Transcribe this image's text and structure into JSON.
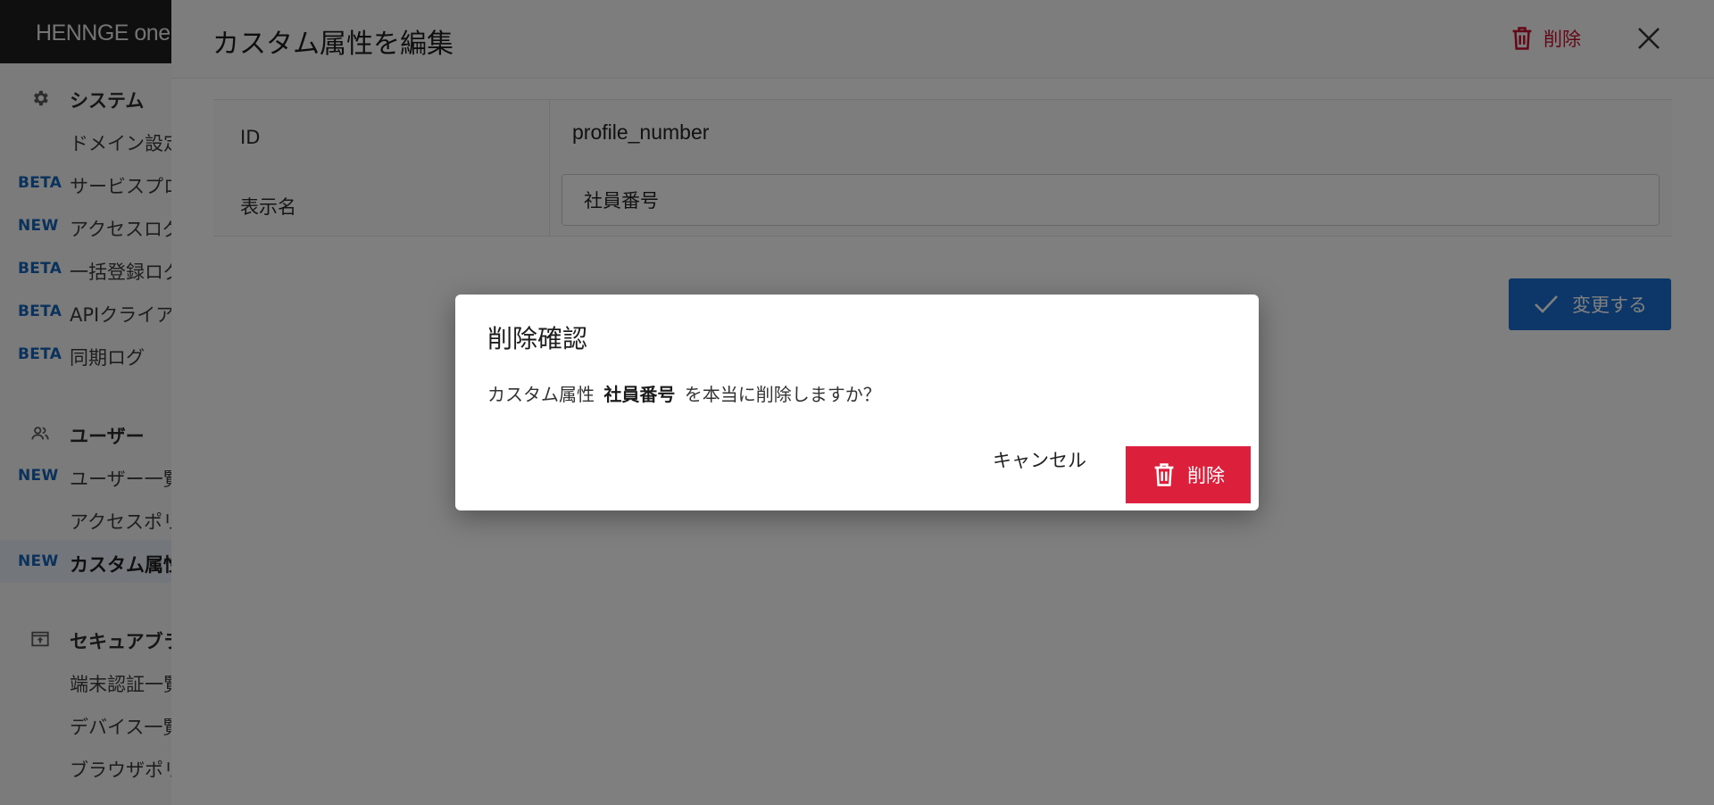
{
  "brand": {
    "name": "HENNGE one"
  },
  "sidebar": {
    "sections": [
      {
        "label": "システム",
        "icon": "gear-icon",
        "items": [
          {
            "badge": "",
            "label": "ドメイン設定"
          },
          {
            "badge": "BETA",
            "label": "サービスプロ"
          },
          {
            "badge": "NEW",
            "label": "アクセスログ"
          },
          {
            "badge": "BETA",
            "label": "一括登録ログ"
          },
          {
            "badge": "BETA",
            "label": "APIクライア"
          },
          {
            "badge": "BETA",
            "label": "同期ログ"
          }
        ]
      },
      {
        "label": "ユーザー",
        "icon": "users-icon",
        "items": [
          {
            "badge": "NEW",
            "label": "ユーザー一覧"
          },
          {
            "badge": "",
            "label": "アクセスポリ"
          },
          {
            "badge": "NEW",
            "label": "カスタム属性",
            "selected": true
          }
        ]
      },
      {
        "label": "セキュアブラ",
        "icon": "browser-icon",
        "items": [
          {
            "badge": "",
            "label": "端末認証一覧"
          },
          {
            "badge": "",
            "label": "デバイス一覧"
          },
          {
            "badge": "",
            "label": "ブラウザポリ"
          }
        ]
      }
    ]
  },
  "panel": {
    "title": "カスタム属性を編集",
    "delete_label": "削除",
    "rows": {
      "id": {
        "key": "ID",
        "value": "profile_number"
      },
      "display_name": {
        "key": "表示名",
        "value": "社員番号"
      }
    },
    "submit_label": "変更する"
  },
  "dialog": {
    "title": "削除確認",
    "message_prefix": "カスタム属性",
    "message_target": "社員番号",
    "message_suffix": "を本当に削除しますか？",
    "cancel_label": "キャンセル",
    "confirm_label": "削除"
  },
  "colors": {
    "accent": "#1a6fd0",
    "danger": "#dc1f3a",
    "badge": "#1565b8"
  }
}
